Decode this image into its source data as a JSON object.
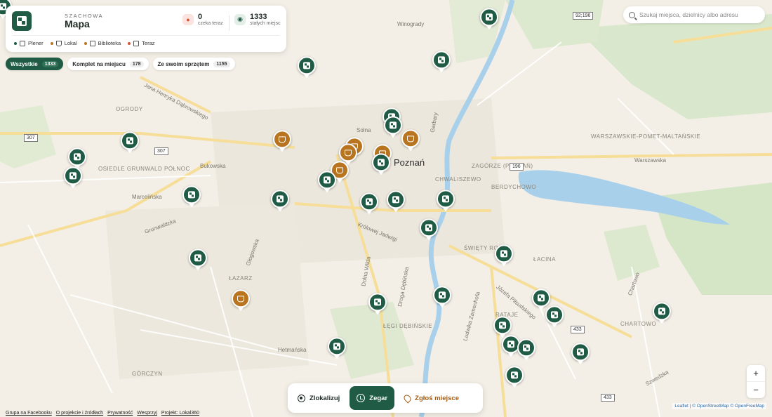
{
  "header": {
    "eyebrow": "SZACHOWA",
    "title": "Mapa",
    "waiting": {
      "value": "0",
      "label": "czeka teraz"
    },
    "places": {
      "value": "1333",
      "label": "stałych miejsc"
    }
  },
  "legend": [
    {
      "label": "Plener",
      "color": "#1f5b45"
    },
    {
      "label": "Lokal",
      "color": "#b8741f"
    },
    {
      "label": "Biblioteka",
      "color": "#b8741f"
    },
    {
      "label": "Teraz",
      "color": "#d2553c"
    }
  ],
  "filters": [
    {
      "label": "Wszystkie",
      "count": "1333",
      "active": true
    },
    {
      "label": "Komplet na miejscu",
      "count": "178",
      "active": false
    },
    {
      "label": "Ze swoim sprzętem",
      "count": "1155",
      "active": false
    }
  ],
  "search": {
    "placeholder": "Szukaj miejsca, dzielnicy albo adresu"
  },
  "zoom": {
    "in": "+",
    "out": "−"
  },
  "bottom": {
    "locate": "Zlokalizuj",
    "clock": "Zegar",
    "report": "Zgłoś miejsce"
  },
  "footer": [
    "Grupa na Facebooku",
    "O projekcie i źródłach",
    "Prywatność",
    "Wesprzyj",
    "Projekt: Lokal360"
  ],
  "attribution": {
    "leaflet": "Leaflet",
    "osm": "© OpenStreetMap",
    "ofm": "© OpenFreeMap"
  },
  "map": {
    "city": "Poznań",
    "districts": [
      "OGRODY",
      "OSIEDLE GRUNWALD PÓŁNOC",
      "ŁAZARZ",
      "GÓRCZYN",
      "ŁĘGI DĘBIŃSKIE",
      "ŚWIĘTY ROCH",
      "ŁACINA",
      "RATAJE",
      "CHARTOWO",
      "BERDYCHOWO",
      "ZAGÓRZE (POZNAŃ)",
      "CHWALISZEWO",
      "WARSZAWSKIE-POMET-MALTAŃSKIE"
    ],
    "streets": [
      "Jana Henryka Dąbrowskiego",
      "Bukowska",
      "Grunwaldzka",
      "Głogowska",
      "Hetmańska",
      "Winogrady",
      "Warszawska",
      "Solna",
      "Garbary",
      "Królowej Jadwigi",
      "Dolna Wilda",
      "Droga Dębińska",
      "Ludwika Zamenhofa",
      "Józefa Piłsudskiego",
      "Chartowo",
      "Marcelińska",
      "Szwedzka"
    ],
    "roads": [
      "307",
      "307",
      "92;196",
      "196",
      "433",
      "433"
    ]
  }
}
